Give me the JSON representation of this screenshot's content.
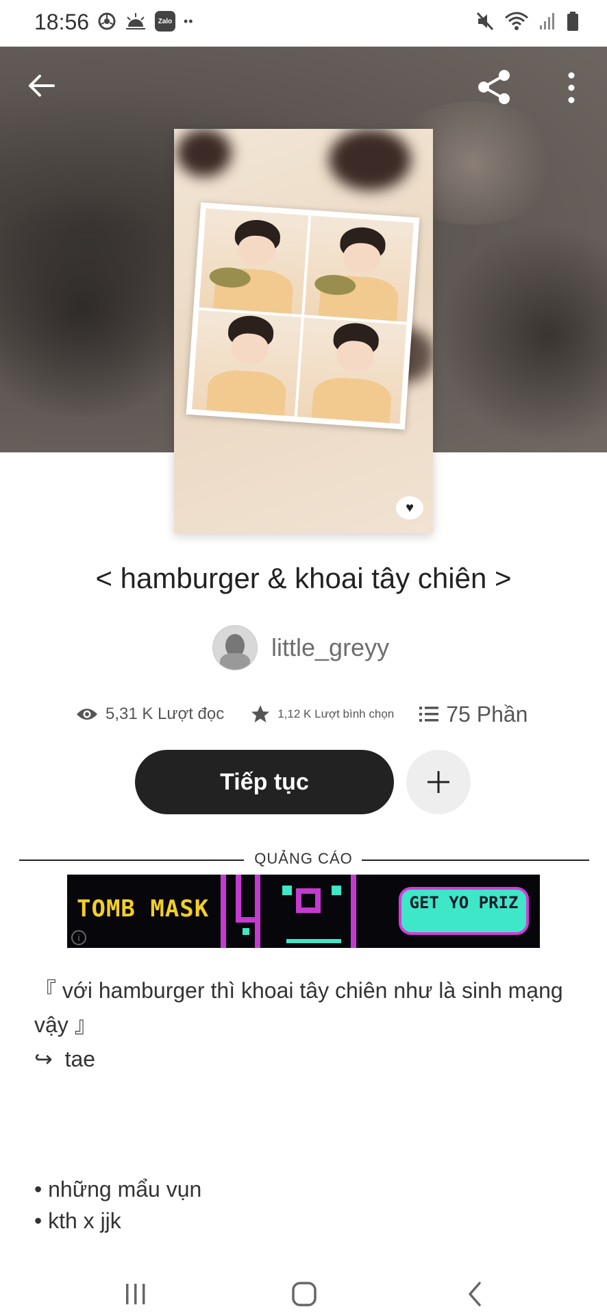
{
  "status_bar": {
    "time": "18:56",
    "left_icons": [
      "chrome-icon",
      "weather-icon",
      "zalo-icon",
      "more-notifications-icon"
    ],
    "zalo_label": "Zalo",
    "more_label": "••",
    "right_icons": [
      "mute-icon",
      "wifi-icon",
      "signal-icon",
      "battery-icon"
    ]
  },
  "header": {
    "back_icon": "back-arrow-icon",
    "share_icon": "share-icon",
    "more_icon": "more-vert-icon"
  },
  "story": {
    "title": "< hamburger & khoai tây chiên >",
    "author": "little_greyy",
    "stats": {
      "reads": "5,31 K Lượt đọc",
      "votes": "1,12 K Lượt bình chọn",
      "parts": "75 Phần"
    },
    "continue_label": "Tiếp tục",
    "add_icon": "plus-icon"
  },
  "ad": {
    "label": "QUẢNG CÁO",
    "logo_text": "TOMB MASK",
    "cta_text": "GET YO PRIZ",
    "info_glyph": "i"
  },
  "description": {
    "line1": "『 với hamburger thì khoai tây chiên như là sinh mạng vậy 』",
    "line2": "↪  tae",
    "tags": [
      "• những mẩu vụn",
      "• kth x jjk"
    ]
  },
  "colors": {
    "button_dark": "#222222",
    "add_button_bg": "#eeeeee",
    "ad_bg": "#07060b",
    "ad_accent_yellow": "#f3cf25",
    "ad_accent_magenta": "#d43bd9",
    "ad_accent_teal": "#3de7c8"
  },
  "navigation_bar": {
    "icons": [
      "recent-apps-icon",
      "home-icon",
      "back-nav-icon"
    ]
  }
}
